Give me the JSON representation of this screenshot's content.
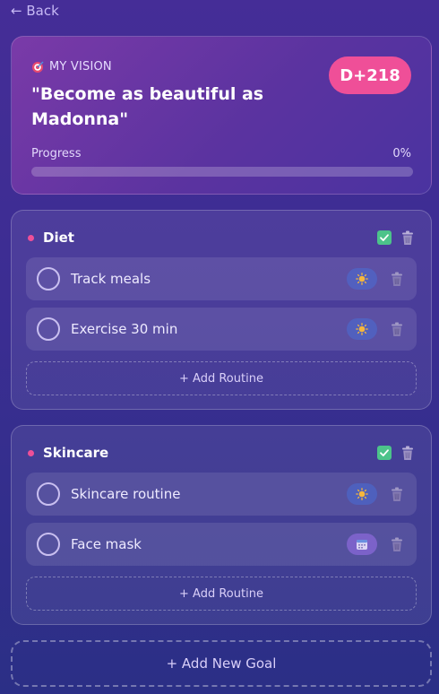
{
  "nav": {
    "back_label": "← Back"
  },
  "vision": {
    "label": "MY VISION",
    "icon": "dart-icon",
    "badge": "D+218",
    "title": "\"Become as beautiful as Madonna\"",
    "progress_label": "Progress",
    "progress_text": "0%",
    "progress_value": 0
  },
  "goals": [
    {
      "title": "Diet",
      "routines": [
        {
          "name": "Track meals",
          "time_icon": "sun-icon"
        },
        {
          "name": "Exercise 30 min",
          "time_icon": "sun-icon"
        }
      ],
      "add_label": "+ Add Routine"
    },
    {
      "title": "Skincare",
      "routines": [
        {
          "name": "Skincare routine",
          "time_icon": "sun-icon"
        },
        {
          "name": "Face mask",
          "time_icon": "calendar-icon"
        }
      ],
      "add_label": "+ Add Routine"
    }
  ],
  "add_goal_label": "+ Add New Goal",
  "colors": {
    "accent_pink": "#ef4f98",
    "check_green": "#4cc38a",
    "sun_yellow": "#f6b73c"
  }
}
